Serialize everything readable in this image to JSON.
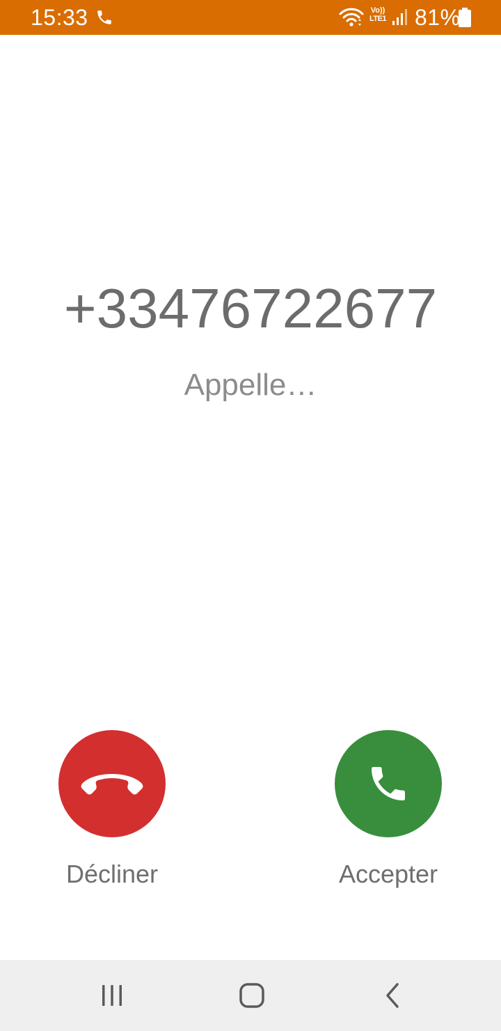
{
  "status_bar": {
    "time": "15:33",
    "volte_line1": "Vo))",
    "volte_line2": "LTE1",
    "battery": "81%",
    "icons": [
      "phone-call-icon",
      "wifi-icon",
      "volte-lte-icon",
      "signal-icon",
      "battery-icon"
    ],
    "background_color": "#d96d02"
  },
  "call": {
    "number": "+33476722677",
    "status": "Appelle…"
  },
  "actions": {
    "decline_label": "Décliner",
    "accept_label": "Accepter",
    "decline_icon": "hang-up-icon",
    "accept_icon": "phone-icon",
    "decline_color": "#d32f2f",
    "accept_color": "#388e3c"
  },
  "nav_bar": {
    "icons": [
      "recents-icon",
      "home-icon",
      "back-icon"
    ]
  }
}
